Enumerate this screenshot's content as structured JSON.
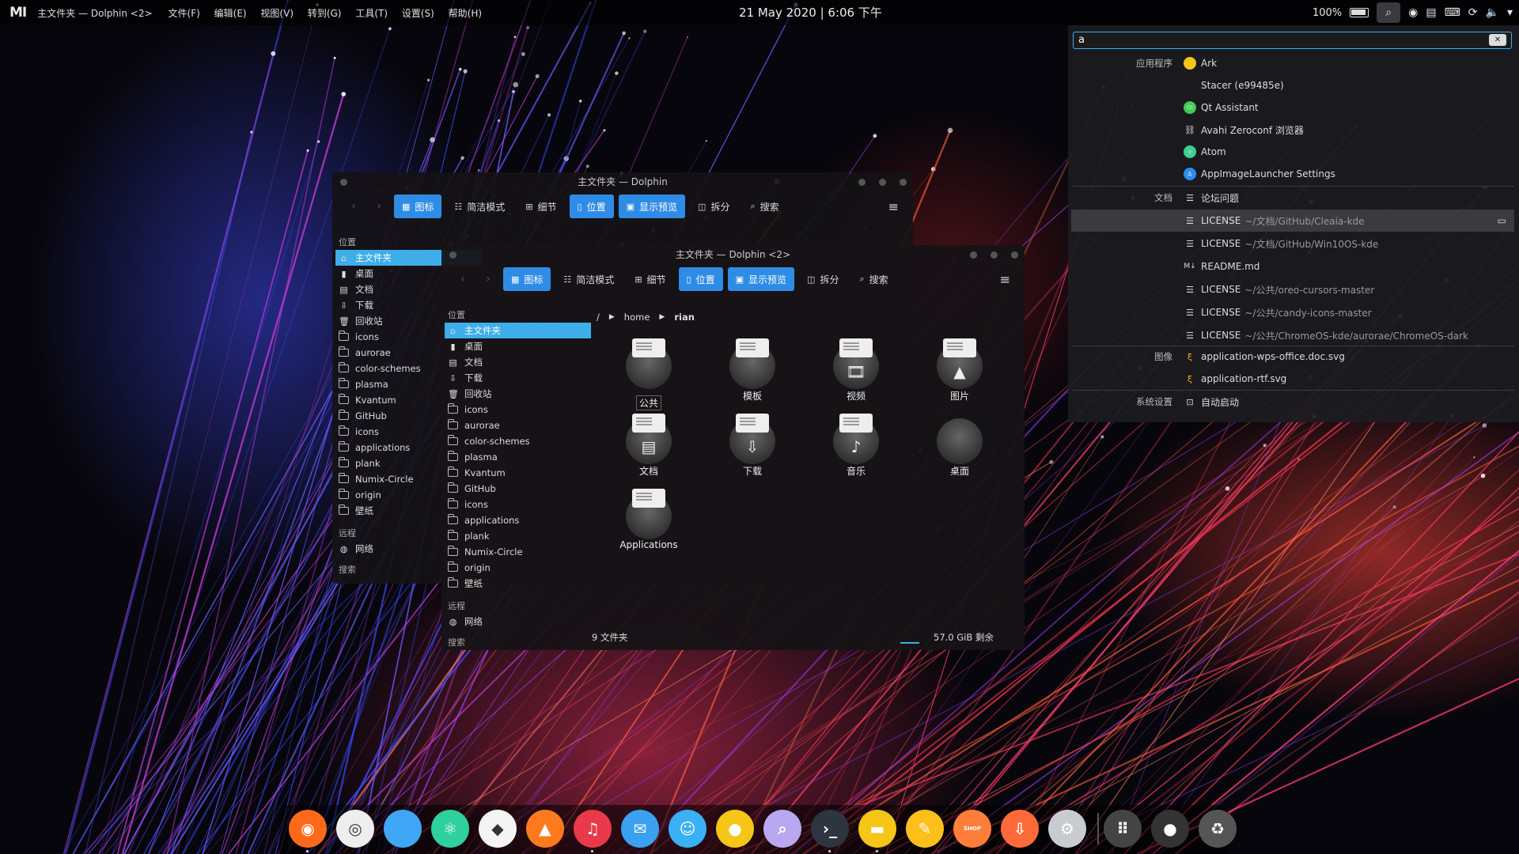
{
  "topbar": {
    "logo": "MI",
    "app_title": "主文件夹 — Dolphin <2>",
    "menus": [
      "文件(F)",
      "编辑(E)",
      "视图(V)",
      "转到(G)",
      "工具(T)",
      "设置(S)",
      "帮助(H)"
    ],
    "clock": "21 May 2020 | 6:06 下午",
    "battery": "100%"
  },
  "krunner": {
    "query": "a",
    "groups": [
      {
        "category": "应用程序",
        "items": [
          {
            "label": "Ark",
            "sub": ""
          },
          {
            "label": "Stacer (e99485e)",
            "sub": ""
          },
          {
            "label": "Qt Assistant",
            "sub": ""
          },
          {
            "label": "Avahi Zeroconf 浏览器",
            "sub": ""
          },
          {
            "label": "Atom",
            "sub": ""
          },
          {
            "label": "AppImageLauncher Settings",
            "sub": ""
          }
        ]
      },
      {
        "category": "文档",
        "items": [
          {
            "label": "论坛问题",
            "sub": ""
          },
          {
            "label": "LICENSE",
            "sub": "~/文档/GitHub/Cleaia-kde"
          },
          {
            "label": "LICENSE",
            "sub": "~/文档/GitHub/Win10OS-kde"
          },
          {
            "label": "README.md",
            "sub": ""
          },
          {
            "label": "LICENSE",
            "sub": "~/公共/oreo-cursors-master"
          },
          {
            "label": "LICENSE",
            "sub": "~/公共/candy-icons-master"
          },
          {
            "label": "LICENSE",
            "sub": "~/公共/ChromeOS-kde/aurorae/ChromeOS-dark"
          }
        ]
      },
      {
        "category": "图像",
        "items": [
          {
            "label": "application-wps-office.doc.svg",
            "sub": ""
          },
          {
            "label": "application-rtf.svg",
            "sub": ""
          }
        ]
      },
      {
        "category": "系统设置",
        "items": [
          {
            "label": "自动启动",
            "sub": ""
          }
        ]
      }
    ]
  },
  "dolphin_back": {
    "title": "主文件夹 — Dolphin"
  },
  "dolphin_front": {
    "title": "主文件夹 — Dolphin <2>"
  },
  "toolbar": {
    "icons": "图标",
    "compact": "简洁模式",
    "details": "细节",
    "location": "位置",
    "preview": "显示预览",
    "split": "拆分",
    "search": "搜索"
  },
  "sidebar": {
    "places_header": "位置",
    "places": [
      "主文件夹",
      "桌面",
      "文档",
      "下载",
      "回收站",
      "icons",
      "aurorae",
      "color-schemes",
      "plasma",
      "Kvantum",
      "GitHub",
      "icons",
      "applications",
      "plank",
      "Numix-Circle",
      "origin",
      "壁纸"
    ],
    "remote_header": "远程",
    "network": "网络",
    "search_header": "搜索"
  },
  "breadcrumb": {
    "root": "/",
    "home": "home",
    "user": "rian"
  },
  "files": [
    {
      "name": "公共",
      "sym": "",
      "selected": true
    },
    {
      "name": "模板",
      "sym": ""
    },
    {
      "name": "视频",
      "sym": "🎞"
    },
    {
      "name": "图片",
      "sym": "▲"
    },
    {
      "name": "文档",
      "sym": "▤"
    },
    {
      "name": "下载",
      "sym": "⇩"
    },
    {
      "name": "音乐",
      "sym": "♪"
    },
    {
      "name": "桌面",
      "sym": ""
    },
    {
      "name": "Applications",
      "sym": ""
    }
  ],
  "status": {
    "count": "9 文件夹",
    "free": "57.0 GiB 剩余"
  },
  "dock": {
    "apps": [
      "firefox-icon",
      "browser-icon",
      "github-icon",
      "atom-icon",
      "inkscape-icon",
      "vlc-icon",
      "netease-music-icon",
      "mail-icon",
      "qq-icon",
      "notes-icon",
      "image-viewer-icon",
      "terminal-icon",
      "files-icon",
      "editor-icon",
      "shop-icon",
      "download-icon",
      "settings-icon",
      "apps-grid-icon",
      "desktop-icon",
      "trash-icon"
    ],
    "shop_label": "SHOP"
  }
}
